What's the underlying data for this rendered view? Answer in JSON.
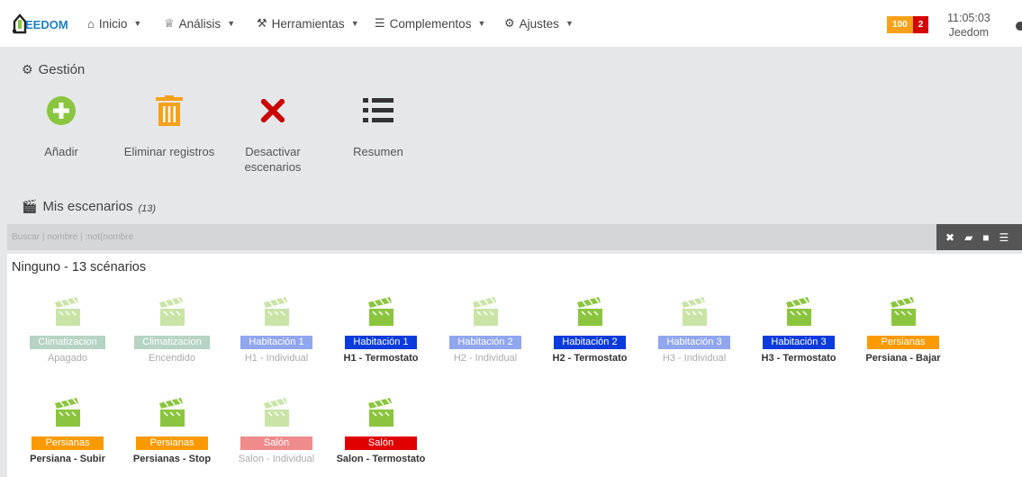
{
  "nav": {
    "logo_text": "EEDOM",
    "items": [
      {
        "label": "Inicio",
        "icon": "home-icon",
        "glyph": "⌂"
      },
      {
        "label": "Análisis",
        "icon": "analysis-icon",
        "glyph": "♕"
      },
      {
        "label": "Herramientas",
        "icon": "wrench-icon",
        "glyph": "⚒"
      },
      {
        "label": "Complementos",
        "icon": "list-icon",
        "glyph": "☰"
      },
      {
        "label": "Ajustes",
        "icon": "gear-icon",
        "glyph": "⚙"
      }
    ],
    "badge_orange": "100",
    "badge_red": "2",
    "time": "11:05:03",
    "user": "Jeedom"
  },
  "gestion": {
    "title": "Gestión",
    "actions": [
      {
        "label": "Añadir",
        "icon": "plus-circle-icon",
        "color": "#8bc53f"
      },
      {
        "label": "Eliminar registros",
        "icon": "trash-icon",
        "color": "#f7a11a"
      },
      {
        "label": "Desactivar escenarios",
        "icon": "close-icon",
        "color": "#cc0000"
      },
      {
        "label": "Resumen",
        "icon": "list-icon",
        "color": "#333333"
      }
    ]
  },
  "scenarios": {
    "title": "Mis escenarios",
    "count": "(13)",
    "search_placeholder": "Buscar | nombre | :not(nombre",
    "group_title": "Ninguno - 13 scénarios",
    "items": [
      {
        "group": "Climatizacion",
        "name": "Apagado",
        "color": "#5e9e7e",
        "active": false
      },
      {
        "group": "Climatizacion",
        "name": "Encendido",
        "color": "#5e9e7e",
        "active": false
      },
      {
        "group": "Habitación 1",
        "name": "H1 - Individual",
        "color": "#0b3bdc",
        "active": false
      },
      {
        "group": "Habitación 1",
        "name": "H1 - Termostato",
        "color": "#0b3bdc",
        "active": true
      },
      {
        "group": "Habitación 2",
        "name": "H2 - Individual",
        "color": "#0b3bdc",
        "active": false
      },
      {
        "group": "Habitación 2",
        "name": "H2 - Termostato",
        "color": "#0b3bdc",
        "active": true
      },
      {
        "group": "Habitación 3",
        "name": "H3 - Individual",
        "color": "#0b3bdc",
        "active": false
      },
      {
        "group": "Habitación 3",
        "name": "H3 - Termostato",
        "color": "#0b3bdc",
        "active": true
      },
      {
        "group": "Persianas",
        "name": "Persiana - Bajar",
        "color": "#fb9a00",
        "active": true
      },
      {
        "group": "Persianas",
        "name": "Persiana - Subir",
        "color": "#fb9a00",
        "active": true
      },
      {
        "group": "Persianas",
        "name": "Persianas - Stop",
        "color": "#fb9a00",
        "active": true
      },
      {
        "group": "Salón",
        "name": "Salon - Individual",
        "color": "#e00000",
        "active": false
      },
      {
        "group": "Salón",
        "name": "Salon - Termostato",
        "color": "#e00000",
        "active": true
      }
    ]
  },
  "colors": {
    "clapper_green": "#8bc53f",
    "accent_blue": "#1a7fc4"
  }
}
